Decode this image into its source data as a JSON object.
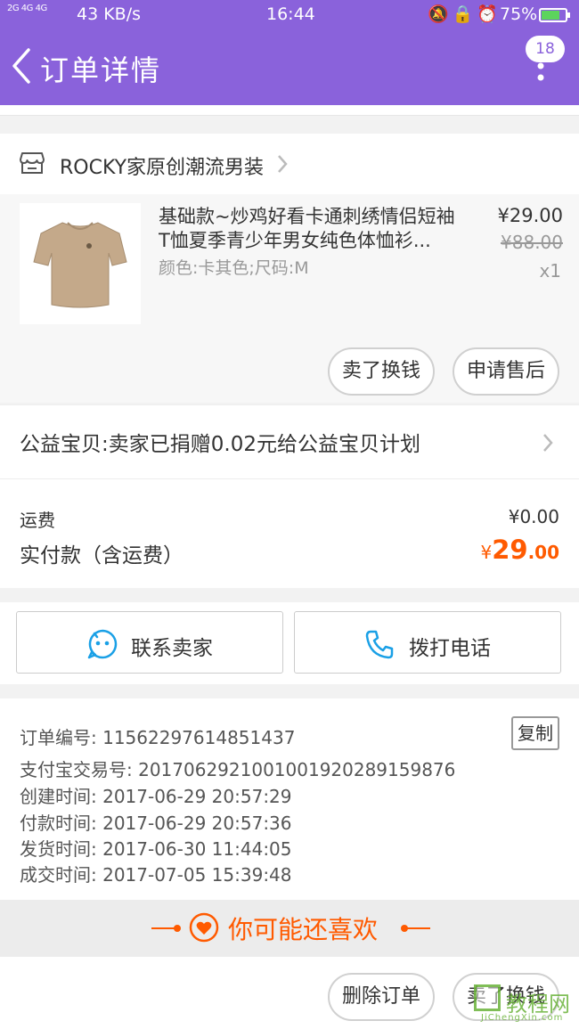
{
  "status_bar": {
    "network": "2G 4G 4G",
    "speed": "43 KB/s",
    "time": "16:44",
    "status_icons": [
      "bell-off-icon",
      "lock-rotate-icon",
      "alarm-icon"
    ],
    "battery": "75%"
  },
  "header": {
    "title": "订单详情",
    "badge_count": "18"
  },
  "shop": {
    "name": "ROCKY家原创潮流男装"
  },
  "product": {
    "name": "基础款~炒鸡好看卡通刺绣情侣短袖T恤夏季青少年男女纯色体恤衫...",
    "sku": "颜色:卡其色;尺码:M",
    "price": "¥29.00",
    "original_price": "¥88.00",
    "quantity": "x1",
    "sell_button": "卖了换钱",
    "aftersale_button": "申请售后"
  },
  "charity": {
    "text": "公益宝贝:卖家已捐赠0.02元给公益宝贝计划"
  },
  "fees": {
    "shipping_label": "运费",
    "shipping_value": "¥0.00",
    "paid_label": "实付款（含运费）",
    "paid_currency": "¥",
    "paid_int": "29",
    "paid_dec": ".00"
  },
  "contact": {
    "seller_label": "联系卖家",
    "phone_label": "拨打电话"
  },
  "order_info": {
    "order_no": "订单编号: 11562297614851437",
    "alipay_no": "支付宝交易号: 2017062921001001920289159876",
    "created": "创建时间: 2017-06-29 20:57:29",
    "paid": "付款时间: 2017-06-29 20:57:36",
    "shipped": "发货时间: 2017-06-30 11:44:05",
    "completed": "成交时间: 2017-07-05 15:39:48",
    "copy_label": "复制"
  },
  "recommend": {
    "title": "你可能还喜欢"
  },
  "bottom": {
    "delete_label": "删除订单",
    "sell_label": "卖了换钱"
  },
  "watermark": {
    "text": "教程网",
    "url": "JiChengXin.com"
  },
  "colors": {
    "header": "#8a62db",
    "accent": "#ff5a00"
  }
}
